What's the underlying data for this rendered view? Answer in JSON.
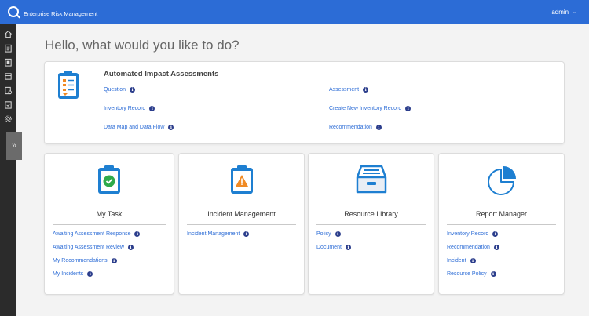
{
  "topbar": {
    "brand_small": "",
    "brand_title": "Enterprise Risk Management",
    "user": "admin",
    "user_chevron": "⌄"
  },
  "sidebar": {
    "icons": [
      "home-icon",
      "assessment-icon",
      "inventory-icon",
      "module-icon",
      "report-icon",
      "task-icon",
      "settings-icon"
    ],
    "expand_glyph": "»"
  },
  "greeting": "Hello, what would you like to do?",
  "automated": {
    "title": "Automated Impact Assessments",
    "links_left": [
      "Question",
      "Inventory Record",
      "Data Map and Data Flow"
    ],
    "links_right": [
      "Assessment",
      "Create New Inventory Record",
      "Recommendation"
    ]
  },
  "cards": [
    {
      "title": "My Task",
      "links": [
        "Awaiting Assessment Response",
        "Awaiting Assessment Review",
        "My Recommendations",
        "My Incidents"
      ]
    },
    {
      "title": "Incident Management",
      "links": [
        "Incident Management"
      ]
    },
    {
      "title": "Resource Library",
      "links": [
        "Policy",
        "Document"
      ]
    },
    {
      "title": "Report Manager",
      "links": [
        "Inventory Record",
        "Recommendation",
        "Incident",
        "Resource Policy"
      ]
    }
  ],
  "info_glyph": "i",
  "colors": {
    "topbar": "#2c6cd6",
    "link": "#2c6cd6",
    "sidebar": "#2b2b2b",
    "info_badge": "#2c3e8c",
    "icon_blue": "#1e7fd1",
    "warning": "#f08a24",
    "success": "#2eaa4a"
  }
}
